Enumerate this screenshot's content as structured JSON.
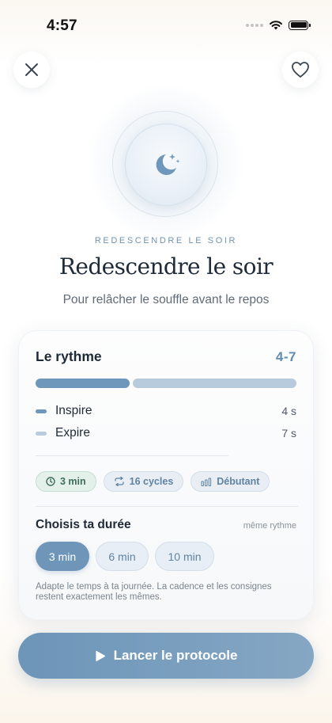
{
  "status_bar": {
    "time": "4:57"
  },
  "hero": {
    "eyebrow": "REDESCENDRE LE SOIR",
    "title": "Redescendre le soir",
    "subtitle": "Pour relâcher le souffle avant le repos",
    "icon": "moon-stars-icon"
  },
  "rhythm": {
    "title": "Le rythme",
    "ratio": "4-7",
    "inhale_fraction": 0.3636,
    "exhale_fraction": 0.6364,
    "phases": [
      {
        "label": "Inspire",
        "duration": "4 s"
      },
      {
        "label": "Expire",
        "duration": "7 s"
      }
    ],
    "colors": {
      "inhale": "#6f97bb",
      "exhale": "#b7cbdd"
    }
  },
  "chips": [
    {
      "label": "3 min",
      "icon": "clock-icon"
    },
    {
      "label": "16 cycles",
      "icon": "repeat-icon"
    },
    {
      "label": "Débutant",
      "icon": "bars-icon"
    }
  ],
  "duration": {
    "title": "Choisis ta durée",
    "note": "même rythme",
    "options": [
      "3 min",
      "6 min",
      "10 min"
    ],
    "selected": "3 min",
    "helper": "Adapte le temps à ta journée. La cadence et les consignes restent exactement les mêmes."
  },
  "cta": {
    "label": "Lancer le protocole",
    "icon": "play-icon"
  },
  "colors": {
    "accent": "#6f96b8",
    "chip_green": "#3f6e5a"
  }
}
